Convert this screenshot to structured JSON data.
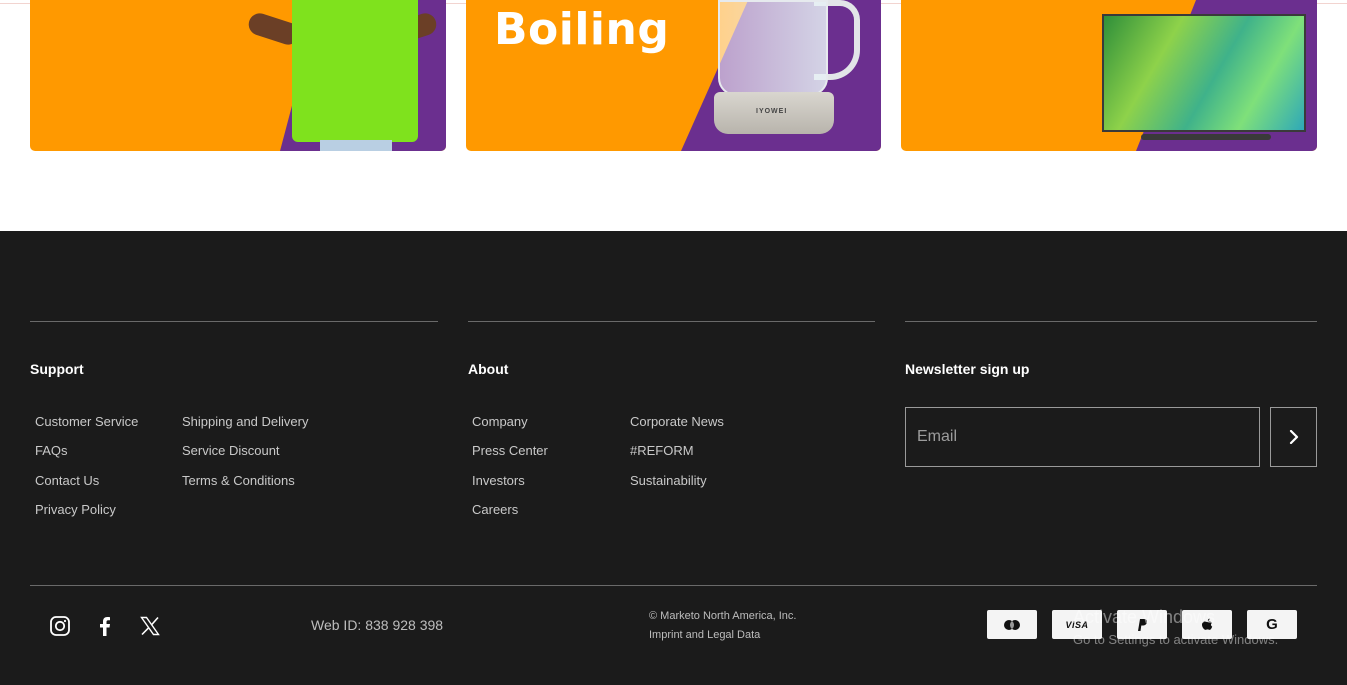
{
  "banners": [
    {
      "name": "tshirt-banner",
      "text": ""
    },
    {
      "name": "kettle-banner",
      "text": "Boiling",
      "brand": "IYOWEI"
    },
    {
      "name": "tv-banner",
      "text": ""
    }
  ],
  "colors": {
    "banner_orange": "#ff9900",
    "banner_purple": "#6b2f8f",
    "footer_bg": "#1b1b1b"
  },
  "footer": {
    "support": {
      "title": "Support",
      "links": [
        "Customer Service",
        "FAQs",
        "Contact Us",
        "Privacy Policy",
        "Shipping and Delivery",
        "Service Discount",
        "Terms & Conditions"
      ]
    },
    "about": {
      "title": "About",
      "links": [
        "Company",
        "Press Center",
        "Investors",
        "Careers",
        "Corporate News",
        "#REFORM",
        "Sustainability"
      ]
    },
    "newsletter": {
      "title": "Newsletter sign up",
      "email_placeholder": "Email",
      "submit_icon": "chevron-right-icon"
    },
    "bottom": {
      "social_icons": [
        "instagram-icon",
        "facebook-icon",
        "x-icon"
      ],
      "web_id": "Web ID: 838 928 398",
      "copyright": "© Marketo North America, Inc.",
      "imprint": "Imprint and Legal Data",
      "payment_icons": [
        "mastercard-icon",
        "visa-icon",
        "paypal-icon",
        "apple-pay-icon",
        "google-pay-icon"
      ],
      "visa_label": "VISA",
      "google_label": "G"
    }
  },
  "watermark": {
    "line1": "Activate Windows",
    "line2": "Go to Settings to activate Windows."
  }
}
